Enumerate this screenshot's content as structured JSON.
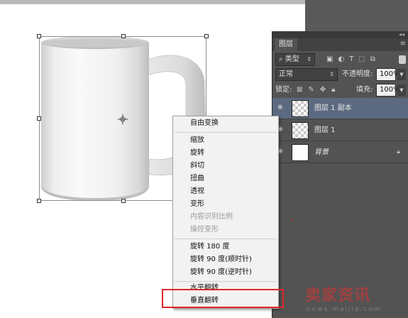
{
  "layers_panel": {
    "tab_label": "图层",
    "filter_kind": "类型",
    "filter_icons": [
      "image-filter-icon",
      "adjustment-filter-icon",
      "type-filter-icon",
      "shape-filter-icon",
      "smart-object-filter-icon"
    ],
    "blend_mode": "正常",
    "opacity_label": "不透明度:",
    "opacity_value": "100%",
    "lock_label": "锁定:",
    "fill_label": "填充:",
    "fill_value": "100%",
    "layers": [
      {
        "name": "图层 1 副本",
        "selected": true
      },
      {
        "name": "图层 1",
        "selected": false
      },
      {
        "name": "背景",
        "selected": false,
        "locked": true
      }
    ]
  },
  "context_menu": {
    "free_transform": "自由变换",
    "scale": "缩放",
    "rotate": "旋转",
    "skew": "斜切",
    "distort": "扭曲",
    "perspective": "透视",
    "warp": "变形",
    "content_aware_scale": "内容识别比例",
    "puppet_warp": "操控变形",
    "rotate_180": "旋转 180 度",
    "rotate_90_cw": "旋转 90 度(顺时针)",
    "rotate_90_ccw": "旋转 90 度(逆时针)",
    "flip_horizontal": "水平翻转",
    "flip_vertical": "垂直翻转"
  },
  "watermark": {
    "brand": "卖家资讯",
    "url": "news.maijia.com"
  },
  "colors": {
    "highlight_box": "#e0262a",
    "selected_layer": "#5b6a80"
  }
}
